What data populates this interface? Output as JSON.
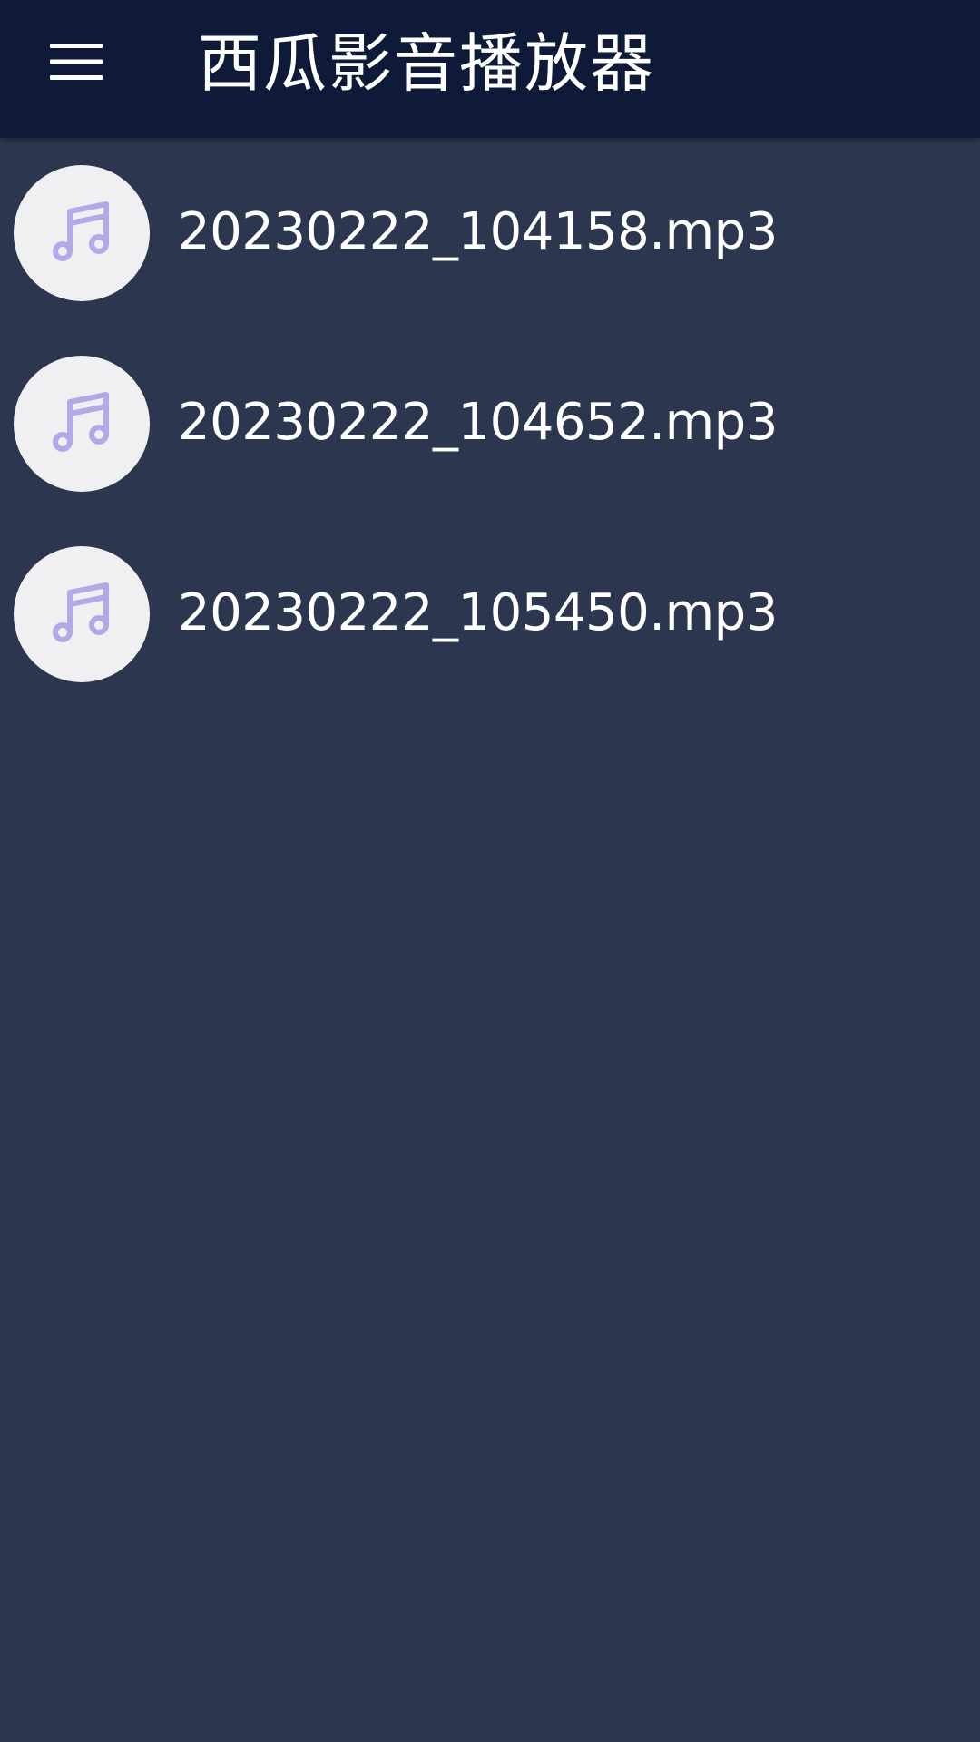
{
  "app": {
    "title": "西瓜影音播放器",
    "menu_icon": "hamburger-menu-icon",
    "colors": {
      "topbar": "#0e1a37",
      "background": "#2c364f",
      "avatar_bg": "#f0f0f2",
      "music_icon": "#b4a8e6",
      "text": "#ffffff"
    }
  },
  "files": [
    {
      "name": "20230222_104158.mp3",
      "icon": "music-note-icon"
    },
    {
      "name": "20230222_104652.mp3",
      "icon": "music-note-icon"
    },
    {
      "name": "20230222_105450.mp3",
      "icon": "music-note-icon"
    }
  ]
}
